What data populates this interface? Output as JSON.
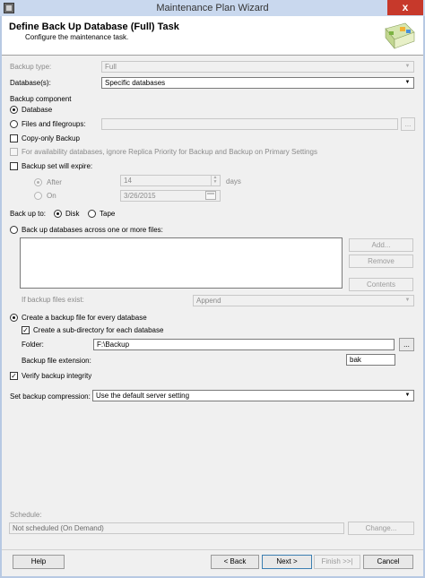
{
  "window": {
    "title": "Maintenance Plan Wizard",
    "close_glyph": "x"
  },
  "header": {
    "title": "Define Back Up Database (Full) Task",
    "subtitle": "Configure the maintenance task."
  },
  "backup_type": {
    "label": "Backup type:",
    "value": "Full"
  },
  "databases": {
    "label": "Database(s):",
    "value": "Specific databases"
  },
  "backup_component": {
    "label": "Backup component",
    "database_label": "Database",
    "files_label": "Files and filegroups:",
    "ellipsis": "..."
  },
  "copy_only": {
    "label": "Copy-only Backup"
  },
  "availability": {
    "label": "For availability databases, ignore Replica Priority for Backup and Backup on Primary Settings"
  },
  "expire": {
    "label": "Backup set will expire:",
    "after_label": "After",
    "after_value": "14",
    "days_label": "days",
    "on_label": "On",
    "on_value": "3/26/2015"
  },
  "backup_to": {
    "label": "Back up to:",
    "disk_label": "Disk",
    "tape_label": "Tape"
  },
  "across_files": {
    "label": "Back up databases across one or more files:",
    "add_label": "Add...",
    "remove_label": "Remove",
    "contents_label": "Contents"
  },
  "if_exist": {
    "label": "If backup files exist:",
    "value": "Append"
  },
  "backup_file": {
    "create_label": "Create a backup file for every database",
    "subdir_label": "Create a sub-directory for each database",
    "folder_label": "Folder:",
    "folder_value": "F:\\Backup",
    "ellipsis": "...",
    "extension_label": "Backup file extension:",
    "extension_value": "bak"
  },
  "verify": {
    "label": "Verify backup integrity"
  },
  "compression": {
    "label": "Set backup compression:",
    "value": "Use the default server setting"
  },
  "schedule": {
    "label": "Schedule:",
    "value": "Not scheduled (On Demand)",
    "change_label": "Change..."
  },
  "footer": {
    "help_label": "Help",
    "back_label": "< Back",
    "next_label": "Next >",
    "finish_label": "Finish >>|",
    "cancel_label": "Cancel"
  },
  "check_glyph": "✓",
  "combo_arrow": "▼"
}
